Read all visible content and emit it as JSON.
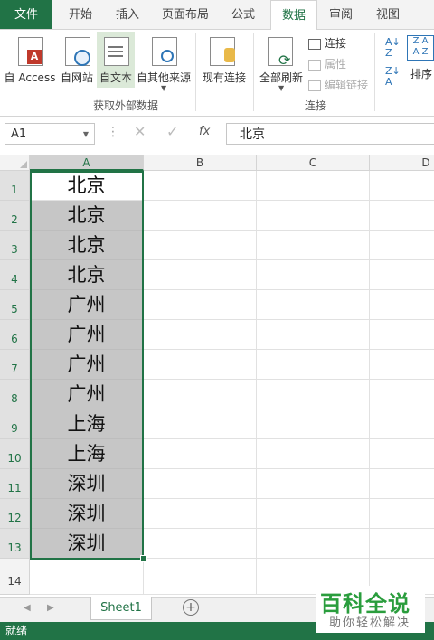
{
  "tabs": [
    "文件",
    "开始",
    "插入",
    "页面布局",
    "公式",
    "数据",
    "审阅",
    "视图"
  ],
  "active_tab": "数据",
  "ribbon": {
    "get_external": {
      "buttons": [
        "自 Access",
        "自网站",
        "自文本",
        "自其他来源"
      ],
      "group_label": "获取外部数据"
    },
    "existing_conn": "现有连接",
    "refresh_all": "全部刷新",
    "connections": {
      "items": [
        "连接",
        "属性",
        "编辑链接"
      ],
      "group_label": "连接"
    },
    "sort": "排序"
  },
  "formula_bar": {
    "name_box": "A1",
    "fx": "fx",
    "formula": "北京"
  },
  "columns": [
    "A",
    "B",
    "C",
    "D"
  ],
  "rows": [
    "1",
    "2",
    "3",
    "4",
    "5",
    "6",
    "7",
    "8",
    "9",
    "10",
    "11",
    "12",
    "13",
    "14"
  ],
  "cells_A": [
    "北京",
    "北京",
    "北京",
    "北京",
    "广州",
    "广州",
    "广州",
    "广州",
    "上海",
    "上海",
    "深圳",
    "深圳",
    "深圳",
    ""
  ],
  "sheet_tab": "Sheet1",
  "status": "就绪",
  "watermark": {
    "title": "百科全说",
    "subtitle": "助你轻松解决"
  },
  "colors": {
    "accent": "#217346",
    "selection": "#c6c6c6",
    "watermark": "#2a9d3d"
  }
}
